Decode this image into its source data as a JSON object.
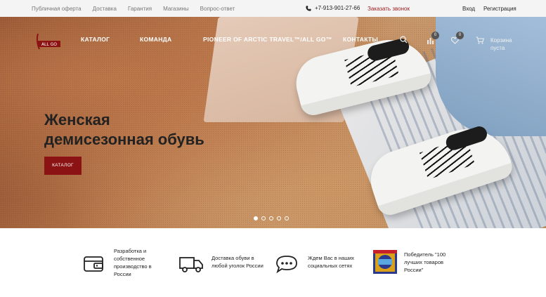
{
  "topbar": {
    "links": [
      "Публичная оферта",
      "Доставка",
      "Гарантия",
      "Магазины",
      "Вопрос-ответ"
    ],
    "phone": "+7-913-901-27-66",
    "callback": "Заказать звонок",
    "login": "Вход",
    "register": "Регистрация"
  },
  "nav": {
    "logo_text": "ALL GO",
    "items": [
      "КАТАЛОГ",
      "КОМАНДА",
      "PIONEER OF ARCTIC TRAVEL™/ALL GO™",
      "КОНТАКТЫ"
    ],
    "compare_count": "0",
    "favorites_count": "0",
    "cart_label_1": "Корзина",
    "cart_label_2": "пуста"
  },
  "hero": {
    "title_line1": "Женская",
    "title_line2": "демисезонная обувь",
    "button": "КАТАЛОГ",
    "slides": 5,
    "active_slide": 1
  },
  "features": [
    {
      "icon": "card-icon",
      "line1": "Разработка и",
      "line2": "собственное",
      "line3": "производство в",
      "line4": "России"
    },
    {
      "icon": "truck-icon",
      "line1": "Доставка обуви в",
      "line2": "любой уголок России"
    },
    {
      "icon": "chat-icon",
      "line1": "Ждем Вас в наших",
      "line2": "социальных сетях"
    },
    {
      "icon": "award-badge-icon",
      "line1": "Победитель \"100",
      "line2": "лучших товаров",
      "line3": "России\""
    }
  ],
  "colors": {
    "accent": "#8b1313",
    "callback": "#9b1c1c"
  }
}
